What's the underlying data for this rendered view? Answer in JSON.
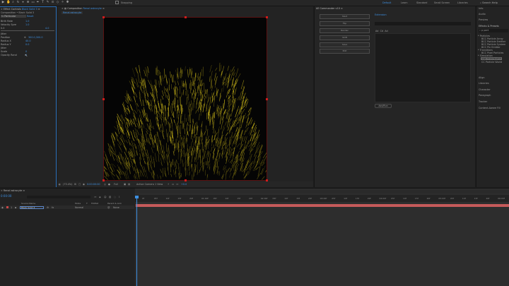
{
  "toolbar": {
    "snapping_label": "Snapping",
    "workspaces": [
      "Default",
      "Learn",
      "Standard",
      "Small Screen",
      "Libraries"
    ],
    "search_label": "Search Help"
  },
  "effect_controls": {
    "tab_label": "Effect Controls",
    "layer_name": "Black Solid 3",
    "path_label": "Composition • Black Solid 3",
    "effect_name": "Particular",
    "reset_label": "Reset",
    "rows": [
      {
        "label": "Birth Rate",
        "value": "1.0"
      },
      {
        "label": "Velocity Spre",
        "value": "1.0"
      },
      {
        "label": "0.0",
        "value": "",
        "right": "4.0"
      },
      {
        "label": "Jitter",
        "value": ""
      },
      {
        "label": "Position",
        "value": "300.0,300.0"
      },
      {
        "label": "Radius X",
        "value": "40.0"
      },
      {
        "label": "Radius Y",
        "value": "0.0"
      },
      {
        "label": "Jitter",
        "value": ""
      },
      {
        "label": "Scale",
        "value": "0"
      },
      {
        "label": "Opacity Rand",
        "value": "0"
      }
    ]
  },
  "composition": {
    "tab_label": "Composition",
    "comp_name": "Renal astrocyte",
    "sub_tab": "Renal astrocyte",
    "footer": {
      "zoom": "(73.4%)",
      "timecode": "0:00:00:00",
      "resolution": "Full",
      "camera": "Active Camera",
      "views": "1 View",
      "exposure": "+0.0"
    }
  },
  "commander": {
    "tab_label": "AE Commander v10",
    "buttons": [
      "Start",
      "Flip",
      "Render",
      "Shift",
      "Save",
      "Edit"
    ],
    "script_title": "Extension",
    "list_header": [
      "Ad",
      "Cd",
      "Ad"
    ],
    "add_label": "Add/Run"
  },
  "right_panel": {
    "items": [
      "Info",
      "Audio",
      "Preview",
      "Effects & Presets",
      "Align",
      "Libraries",
      "Character",
      "Paragraph",
      "Tracker",
      "Content-Aware Fill"
    ],
    "search_value": "p part",
    "tree": [
      "* Particles",
      "BCC Particle Array",
      "BCC Particle Emitter",
      "BCC Particle System",
      "BCC Pin Emitter",
      "* Transitions",
      "BCC Pixel Particles",
      "* Simulation",
      "CC Particle Systems II",
      "CC Particle World"
    ]
  },
  "timeline": {
    "tab_label": "Renal astrocyte",
    "timecode": "0:00:00",
    "columns": [
      "Source Name",
      "Mode",
      "T",
      "TrkMat",
      "Parent & Link"
    ],
    "layer": {
      "number": "1",
      "name": "Black Solid 3",
      "mode": "Normal",
      "parent": "None"
    },
    "ruler_ticks": [
      "0f",
      "05f",
      "10f",
      "15f",
      "20f",
      "01:00f",
      "05f",
      "10f",
      "15f",
      "20f",
      "02:00f",
      "05f",
      "10f",
      "15f",
      "20f",
      "03:00f",
      "05f",
      "10f",
      "15f",
      "20f",
      "04:00f",
      "05f",
      "10f",
      "15f",
      "20f",
      "05:00f",
      "05f",
      "10f",
      "15f",
      "20f",
      "06:00f"
    ]
  },
  "colors": {
    "accent": "#3d8fe0",
    "particle": "#d8c21a",
    "layer_bar": "#c55a5a"
  }
}
